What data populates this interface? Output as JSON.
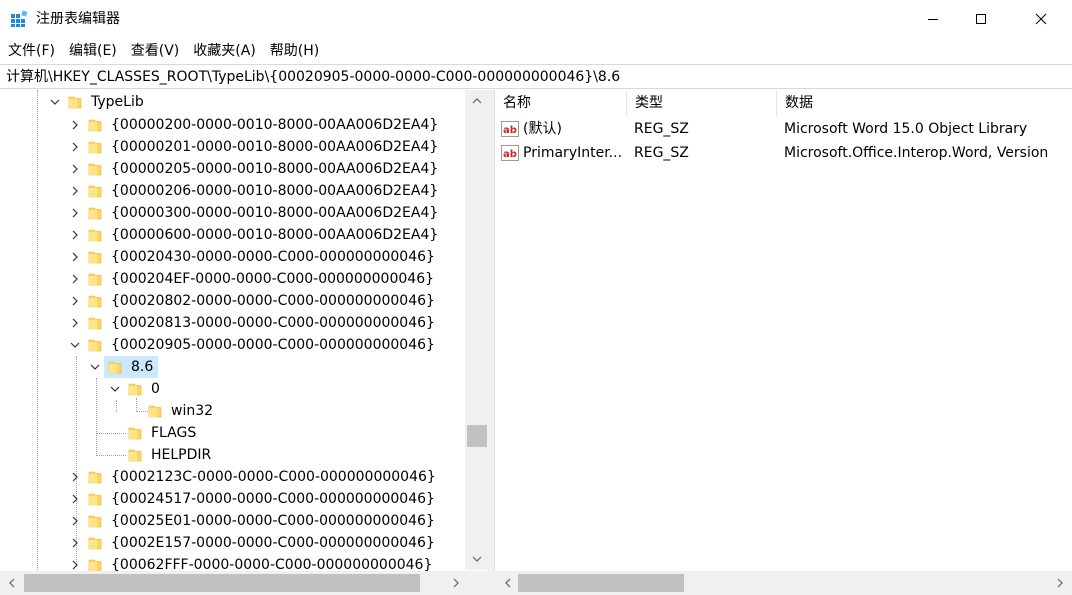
{
  "window": {
    "title": "注册表编辑器"
  },
  "menu": {
    "file": "文件(F)",
    "edit": "编辑(E)",
    "view": "查看(V)",
    "favorites": "收藏夹(A)",
    "help": "帮助(H)"
  },
  "address": {
    "path": "计算机\\HKEY_CLASSES_ROOT\\TypeLib\\{00020905-0000-0000-C000-000000000046}\\8.6"
  },
  "tree": {
    "typelib": "TypeLib",
    "items": [
      "{00000200-0000-0010-8000-00AA006D2EA4}",
      "{00000201-0000-0010-8000-00AA006D2EA4}",
      "{00000205-0000-0010-8000-00AA006D2EA4}",
      "{00000206-0000-0010-8000-00AA006D2EA4}",
      "{00000300-0000-0010-8000-00AA006D2EA4}",
      "{00000600-0000-0010-8000-00AA006D2EA4}",
      "{00020430-0000-0000-C000-000000000046}",
      "{000204EF-0000-0000-C000-000000000046}",
      "{00020802-0000-0000-C000-000000000046}",
      "{00020813-0000-0000-C000-000000000046}",
      "{00020905-0000-0000-C000-000000000046}"
    ],
    "sub": {
      "version": "8.6",
      "zero": "0",
      "win32": "win32",
      "flags": "FLAGS",
      "helpdir": "HELPDIR"
    },
    "after_items": [
      "{0002123C-0000-0000-C000-000000000046}",
      "{00024517-0000-0000-C000-000000000046}",
      "{00025E01-0000-0000-C000-000000000046}",
      "{0002E157-0000-0000-C000-000000000046}",
      "{00062FFF-0000-0000-C000-000000000046}"
    ]
  },
  "list": {
    "columns": {
      "name": "名称",
      "type": "类型",
      "data": "数据"
    },
    "rows": [
      {
        "name": "(默认)",
        "type": "REG_SZ",
        "data": "Microsoft Word 15.0 Object Library"
      },
      {
        "name": "PrimaryInter...",
        "type": "REG_SZ",
        "data": "Microsoft.Office.Interop.Word, Version"
      }
    ]
  },
  "icons": {
    "app": "registry-editor-icon",
    "folder": "folder-icon",
    "string_value": "string-value-icon"
  },
  "colors": {
    "selection": "#cce8ff",
    "folder": "#ffd75e",
    "scroll_thumb": "#c1c1c1"
  }
}
